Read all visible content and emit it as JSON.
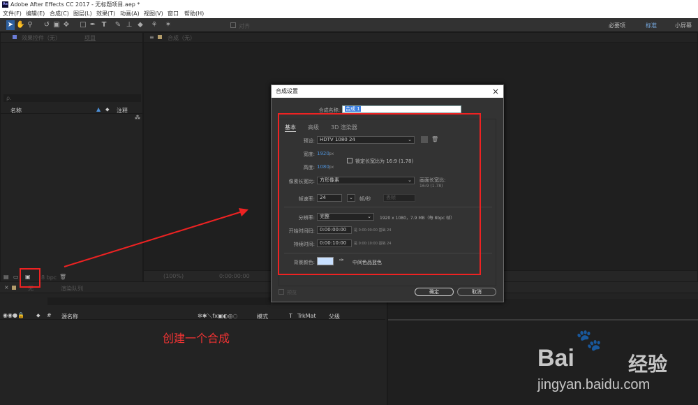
{
  "window": {
    "title": "Adobe After Effects CC 2017 - 无标题项目.aep *",
    "logo": "Ae"
  },
  "menu": [
    "文件(F)",
    "编辑(E)",
    "合成(C)",
    "图层(L)",
    "效果(T)",
    "动画(A)",
    "视图(V)",
    "窗口",
    "帮助(H)"
  ],
  "workspaces": [
    "必要项",
    "标准",
    "小屏幕"
  ],
  "tools": [
    "selection-tool",
    "hand-tool",
    "zoom-tool",
    "rotate-tool",
    "camera-tool",
    "pan-tool",
    "rectangle-tool",
    "pen-tool",
    "text-tool",
    "brush-tool",
    "clone-tool",
    "eraser-tool",
    "roto-tool",
    "puppet-tool"
  ],
  "toolbar": {
    "snap_label": "对齐"
  },
  "effects_panel": {
    "tab_label": "效果控件（无）",
    "tab2_label": "项目"
  },
  "project_panel": {
    "col_name": "名称",
    "col_comment": "注释",
    "bpc": "8 bpc",
    "search_placeholder": "ρ."
  },
  "comp_viewer": {
    "tab_label": "合成（无）",
    "zoom": "(100%)",
    "timecode": "0:00:00:00"
  },
  "dialog": {
    "title": "合成设置",
    "name_label": "合成名称:",
    "name_value": "合成 1",
    "tabs": [
      "基本",
      "高级",
      "3D 渲染器"
    ],
    "preset_label": "预设:",
    "preset_value": "HDTV 1080 24",
    "width_label": "宽度:",
    "width_value": "1920",
    "width_unit": "px",
    "height_label": "高度:",
    "height_value": "1080",
    "height_unit": "px",
    "lock_label": "锁定长宽比为 16:9 (1.78)",
    "par_label": "像素长宽比:",
    "par_value": "方形像素",
    "frame_ar_label": "画面长宽比:",
    "frame_ar_value": "16:9 (1.78)",
    "fps_label": "帧速率:",
    "fps_value": "24",
    "fps_unit": "帧/秒",
    "fps_drop": "丢帧",
    "res_label": "分辨率:",
    "res_value": "完整",
    "res_info": "1920 x 1080，7.9 MB（每 8bpc 帧）",
    "start_label": "开始时间码:",
    "start_value": "0:00:00:00",
    "start_info": "是 0:00:00:00 基础 24",
    "dur_label": "持续时间:",
    "dur_value": "0:00:10:00",
    "dur_info": "是 0:00:10:00 基础 24",
    "bg_label": "背景颜色:",
    "bg_value": "中间色品蓝色",
    "bg_color": "#c8e0ff",
    "preview_label": "预览",
    "ok": "确定",
    "cancel": "取消"
  },
  "timeline": {
    "tab_label": "无",
    "render_tab": "渲染队列",
    "cols": {
      "source": "源名称",
      "mode": "模式",
      "t": "T",
      "trkmat": "TrkMat",
      "parent": "父级"
    }
  },
  "annotation": "创建一个合成",
  "watermark": {
    "brand": "Bai",
    "brand2": "经验",
    "url": "jingyan.baidu.com"
  }
}
